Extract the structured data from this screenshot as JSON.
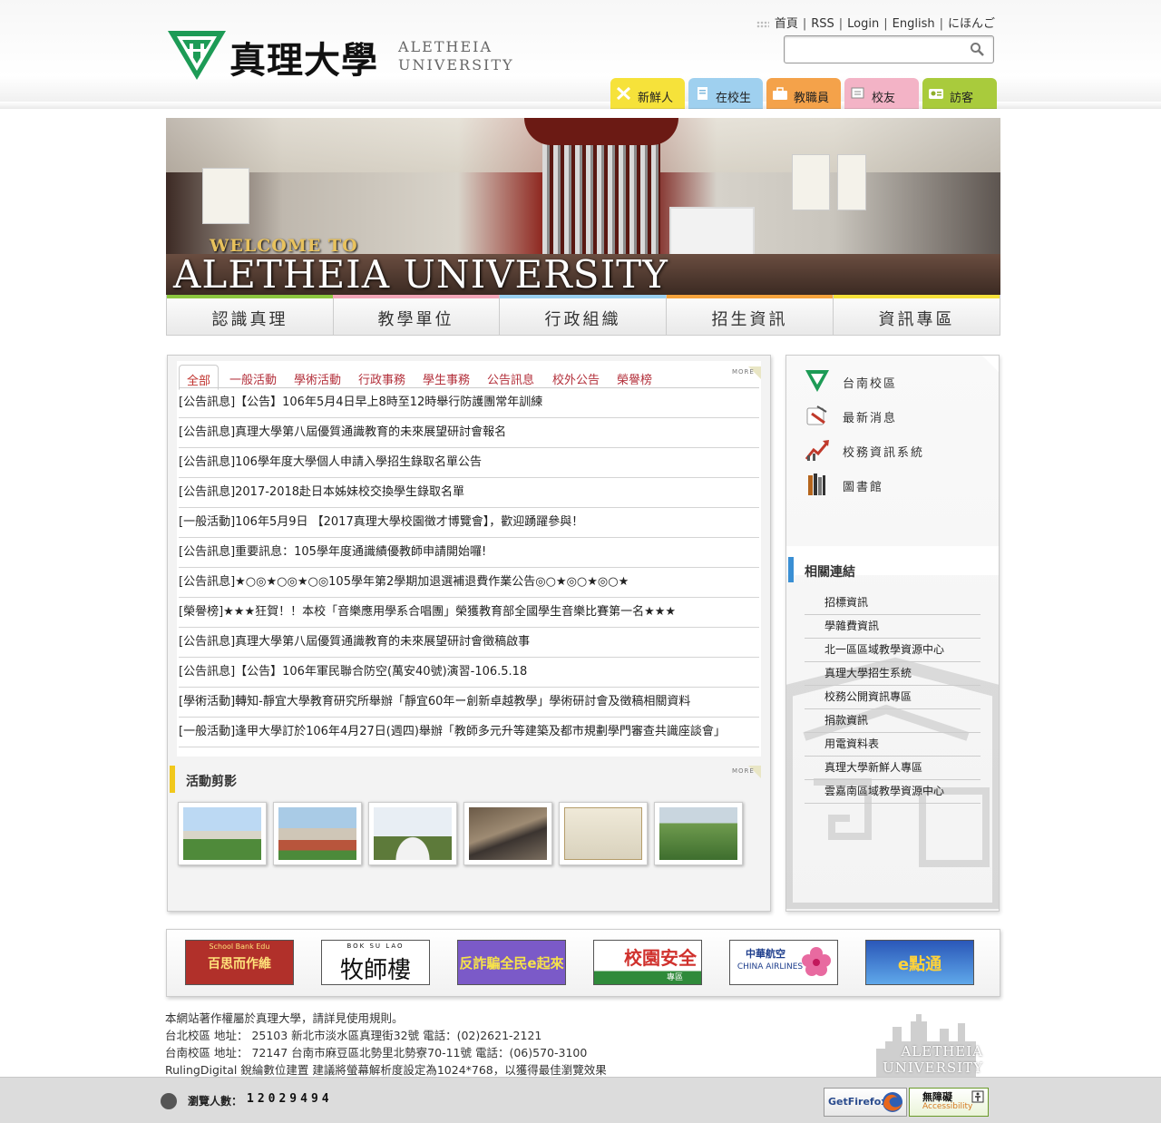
{
  "header": {
    "logo_cn": "真理大學",
    "logo_en_1": "ALETHEIA",
    "logo_en_2": "UNIVERSITY",
    "top_links": [
      "首頁",
      "RSS",
      "Login",
      "English",
      "にほんご"
    ],
    "search_placeholder": ""
  },
  "audience_tabs": [
    {
      "label": "新鮮人",
      "color": "#f6e23a",
      "icon": "pencil-ruler-icon"
    },
    {
      "label": "在校生",
      "color": "#9fd0ef",
      "icon": "notebook-icon"
    },
    {
      "label": "教職員",
      "color": "#f4a24a",
      "icon": "briefcase-icon"
    },
    {
      "label": "校友",
      "color": "#f3b3c6",
      "icon": "diploma-icon"
    },
    {
      "label": "訪客",
      "color": "#a9cb3c",
      "icon": "visitor-card-icon"
    }
  ],
  "banner": {
    "welcome": "WELCOME TO",
    "title": "ALETHEIA UNIVERSITY"
  },
  "main_nav": [
    {
      "label": "認識真理",
      "accent": "#8cc63f"
    },
    {
      "label": "教學單位",
      "accent": "#f3a6b8"
    },
    {
      "label": "行政組織",
      "accent": "#9ad0f0"
    },
    {
      "label": "招生資訊",
      "accent": "#f4a33c"
    },
    {
      "label": "資訊專區",
      "accent": "#f5e13a"
    }
  ],
  "news": {
    "tabs": [
      "全部",
      "一般活動",
      "學術活動",
      "行政事務",
      "學生事務",
      "公告訊息",
      "校外公告",
      "榮譽榜"
    ],
    "more_label": "MORE",
    "items": [
      "[公告訊息]【公告】106年5月4日早上8時至12時舉行防護團常年訓練",
      "[公告訊息]真理大學第八屆優質通識教育的未來展望研討會報名",
      "[公告訊息]106學年度大學個人申請入學招生錄取名單公告",
      "[公告訊息]2017-2018赴日本姊妹校交換學生錄取名單",
      "[一般活動]106年5月9日 【2017真理大學校園徵才博覽會】，歡迎踴躍參與！",
      "[公告訊息]重要訊息：105學年度通識績優教師申請開始囉!",
      "[公告訊息]★○◎★○◎★○◎105學年第2學期加退選補退費作業公告◎○★◎○★◎○★",
      "[榮譽榜]★★★狂賀！！本校「音樂應用學系合唱團」榮獲教育部全國學生音樂比賽第一名★★★",
      "[公告訊息]真理大學第八屆優質通識教育的未來展望研討會徵稿啟事",
      "[公告訊息]【公告】106年軍民聯合防空(萬安40號)演習-106.5.18",
      "[學術活動]轉知-靜宜大學教育研究所舉辦「靜宜60年ー創新卓越教學」學術研討會及徵稿相關資料",
      "[一般活動]逢甲大學訂於106年4月27日(週四)舉辦「教師多元升等建築及都市規劃學門審查共識座談會」"
    ]
  },
  "photos": {
    "title": "活動剪影",
    "more_label": "MORE",
    "thumbs": [
      "campus-buildings-photo",
      "running-track-photo",
      "arch-sculpture-photo",
      "historic-cannon-photo",
      "campus-map-board-photo",
      "aerial-campus-photo"
    ]
  },
  "quick_links": [
    {
      "label": "台南校區",
      "icon": "school-badge-icon"
    },
    {
      "label": "最新消息",
      "icon": "megaphone-icon"
    },
    {
      "label": "校務資訊系統",
      "icon": "chart-arrow-icon"
    },
    {
      "label": "圖書館",
      "icon": "books-icon"
    }
  ],
  "related": {
    "title": "相關連結",
    "items": [
      "招標資訊",
      "學雜費資訊",
      "北一區區域教學資源中心",
      "真理大學招生系統",
      "校務公開資訊專區",
      "捐款資訊",
      "用電資料表",
      "真理大學新鮮人專區",
      "雲嘉南區域教學資源中心"
    ]
  },
  "partners": [
    {
      "text": "百思而作維",
      "sub": "School Bank Edu",
      "bg": "#b1302a",
      "fg": "#ffe27a"
    },
    {
      "text": "牧師樓",
      "sub": "BOK  SU  LAO",
      "bg": "#ffffff",
      "fg": "#111111"
    },
    {
      "text": "反詐騙全民e起來",
      "sub": "",
      "bg": "#7b5ac8",
      "fg": "#f6e24a"
    },
    {
      "text": "校園安全",
      "sub": "專區",
      "bg": "#ffffff",
      "fg": "#d0312d"
    },
    {
      "text": "中華航空",
      "sub": "CHINA AIRLINES",
      "bg": "#ffffff",
      "fg": "#1d3d8c"
    },
    {
      "text": "e點通",
      "sub": "",
      "bg": "#2a57b8",
      "fg": "#ffd23a"
    }
  ],
  "footer": {
    "lines": [
      "本網站著作權屬於真理大學，請詳見使用規則。",
      "台北校區 地址： 25103 新北市淡水區真理街32號 電話：(02)2621-2121",
      "台南校區 地址： 72147 台南市麻豆區北勢里北勢寮70-11號 電話：(06)570-3100",
      "RulingDigital 銳綸數位建置 建議將螢幕解析度設定為1024*768，以獲得最佳瀏覽效果"
    ],
    "logo_en_1": "ALETHEIA",
    "logo_en_2": "UNIVERSITY",
    "counter_label": "瀏覽人數：",
    "counter_value": "12029494",
    "firefox_label": "GetFirefox",
    "accessibility_label_1": "無障礙",
    "accessibility_label_2": "Accessibility"
  }
}
